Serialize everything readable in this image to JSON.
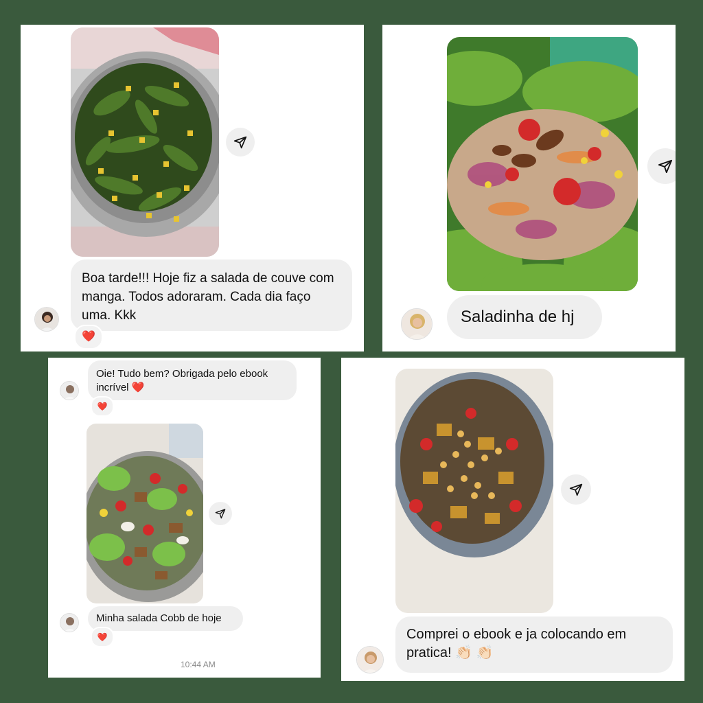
{
  "colors": {
    "background": "#3a5a3d",
    "panel": "#ffffff",
    "bubble": "#efefef",
    "heart": "#e0242f"
  },
  "icons": {
    "share": "paper-plane-icon",
    "reaction": "red-heart-icon",
    "clap": "clapping-hands-icon"
  },
  "panel1": {
    "message": "Boa tarde!!! Hoje fiz a salada de couve com manga. Todos adoraram. Cada dia faço uma. Kkk",
    "reaction": "❤️"
  },
  "panel2": {
    "message": "Saladinha de hj"
  },
  "panel3": {
    "message1": "Oie! Tudo bem? Obrigada pelo ebook incrível ❤️",
    "reaction1": "❤️",
    "message2": "Minha salada Cobb de hoje",
    "reaction2": "❤️",
    "timestamp": "10:44 AM"
  },
  "panel4": {
    "message": "Comprei o ebook e ja colocando em pratica! 👏🏻 👏🏻"
  }
}
